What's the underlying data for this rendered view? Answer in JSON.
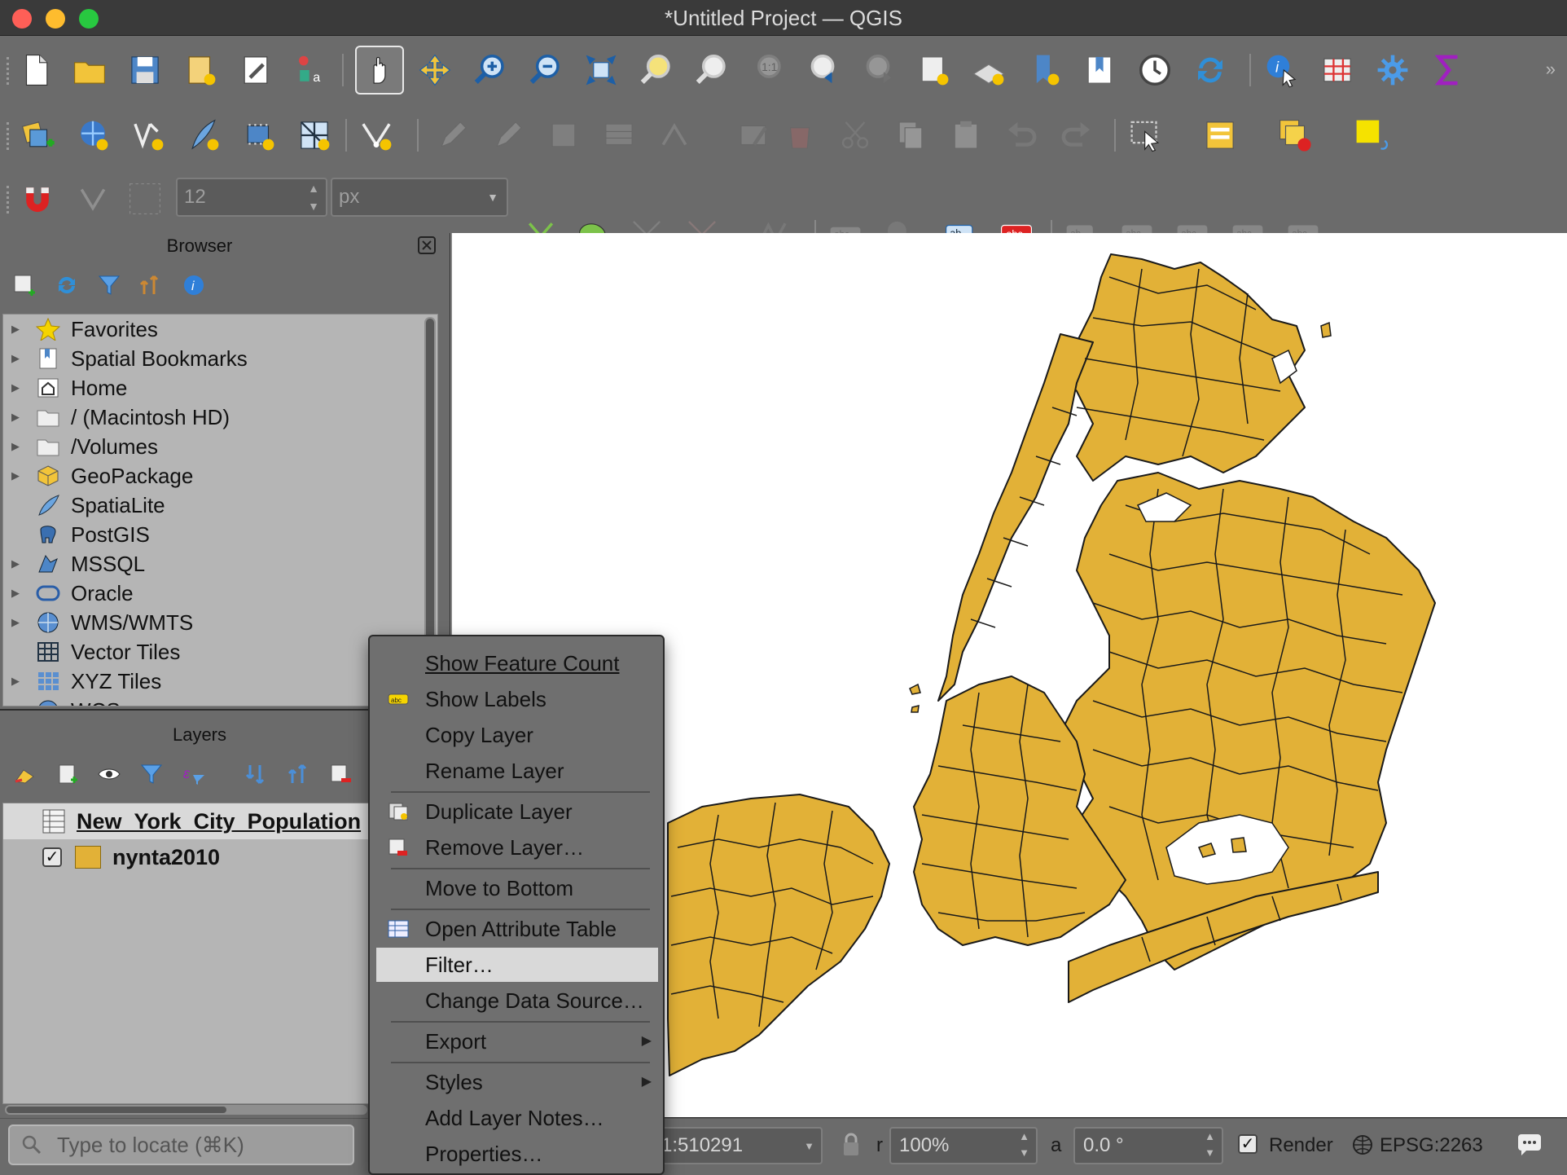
{
  "window": {
    "title": "*Untitled Project — QGIS"
  },
  "toolbar": {
    "snap_tolerance": "12",
    "snap_units": "px"
  },
  "browser": {
    "title": "Browser",
    "items": [
      {
        "label": "Favorites",
        "icon": "star-icon",
        "expandable": true
      },
      {
        "label": "Spatial Bookmarks",
        "icon": "bookmark-icon",
        "expandable": true
      },
      {
        "label": "Home",
        "icon": "home-icon",
        "expandable": true
      },
      {
        "label": "/ (Macintosh HD)",
        "icon": "folder-icon",
        "expandable": true
      },
      {
        "label": "/Volumes",
        "icon": "folder-icon",
        "expandable": true
      },
      {
        "label": "GeoPackage",
        "icon": "geopackage-icon",
        "expandable": true
      },
      {
        "label": "SpatiaLite",
        "icon": "feather-icon",
        "expandable": false
      },
      {
        "label": "PostGIS",
        "icon": "elephant-icon",
        "expandable": false
      },
      {
        "label": "MSSQL",
        "icon": "mssql-icon",
        "expandable": true
      },
      {
        "label": "Oracle",
        "icon": "oracle-icon",
        "expandable": true
      },
      {
        "label": "WMS/WMTS",
        "icon": "globe-icon",
        "expandable": true
      },
      {
        "label": "Vector Tiles",
        "icon": "grid-icon",
        "expandable": false
      },
      {
        "label": "XYZ Tiles",
        "icon": "tiles-icon",
        "expandable": true
      },
      {
        "label": "WCS",
        "icon": "globe-icon",
        "expandable": true
      }
    ]
  },
  "layers": {
    "title": "Layers",
    "items": [
      {
        "label": "New_York_City_Population",
        "icon": "table-icon",
        "selected": true
      },
      {
        "label": "nynta2010",
        "icon": "polygon-fill-icon",
        "checked": true,
        "color": "#e2b137"
      }
    ]
  },
  "context_menu": {
    "items": [
      {
        "label": "Show Feature Count",
        "underline": "F"
      },
      {
        "label": "Show Labels",
        "icon": "labels-icon"
      },
      {
        "label": "Copy Layer"
      },
      {
        "label": "Rename Layer"
      },
      {
        "label": "Duplicate Layer",
        "icon": "duplicate-icon"
      },
      {
        "label": "Remove Layer…",
        "icon": "remove-layer-icon"
      },
      {
        "label": "Move to Bottom"
      },
      {
        "label": "Open Attribute Table",
        "icon": "attribute-table-icon"
      },
      {
        "label": "Filter…",
        "highlighted": true
      },
      {
        "label": "Change Data Source…"
      },
      {
        "label": "Export",
        "submenu": true
      },
      {
        "label": "Styles",
        "submenu": true
      },
      {
        "label": "Add Layer Notes…"
      },
      {
        "label": "Properties…"
      }
    ]
  },
  "status": {
    "locate_placeholder": "Type to locate (⌘K)",
    "scale": "1:510291",
    "magnifier_label": "r",
    "magnifier": "100%",
    "rotation_label": "a",
    "rotation": "0.0 °",
    "render_label": "Render",
    "crs": "EPSG:2263"
  },
  "colors": {
    "map_fill": "#e2b137",
    "panel": "#6b6b6b",
    "highlight": "#d9d9d9"
  }
}
